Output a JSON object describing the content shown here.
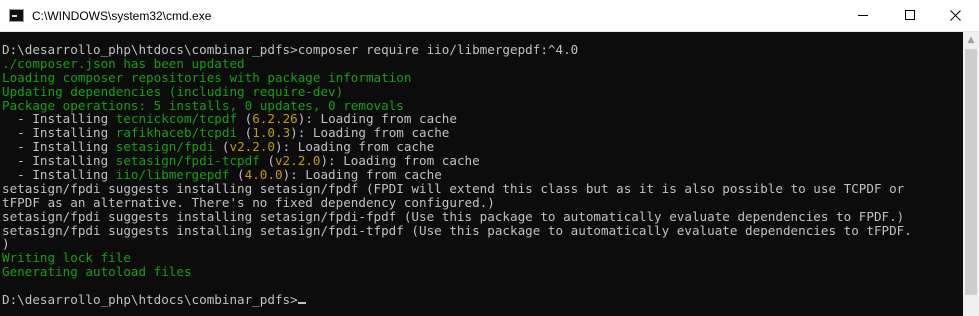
{
  "window": {
    "title": "C:\\WINDOWS\\system32\\cmd.exe"
  },
  "console": {
    "command_prompt": "D:\\desarrollo_php\\htdocs\\combinar_pdfs>composer require iio/libmergepdf:^4.0",
    "updated_json": "./composer.json has been updated",
    "loading_repos": "Loading composer repositories with package information",
    "updating_deps": "Updating dependencies (including require-dev)",
    "package_ops": "Package operations: 5 installs, 0 updates, 0 removals",
    "installs": [
      {
        "prefix": "  - Installing ",
        "name": "tecnickcom/tcpdf",
        "version": "6.2.26",
        "suffix": "): Loading from cache"
      },
      {
        "prefix": "  - Installing ",
        "name": "rafikhaceb/tcpdi",
        "version": "1.0.3",
        "suffix": "): Loading from cache"
      },
      {
        "prefix": "  - Installing ",
        "name": "setasign/fpdi",
        "version": "v2.2.0",
        "suffix": "): Loading from cache"
      },
      {
        "prefix": "  - Installing ",
        "name": "setasign/fpdi-tcpdf",
        "version": "v2.2.0",
        "suffix": "): Loading from cache"
      },
      {
        "prefix": "  - Installing ",
        "name": "iio/libmergepdf",
        "version": "4.0.0",
        "suffix": "): Loading from cache"
      }
    ],
    "suggest_lines": [
      "setasign/fpdi suggests installing setasign/fpdf (FPDI will extend this class but as it is also possible to use TCPDF or",
      "tFPDF as an alternative. There's no fixed dependency configured.)",
      "setasign/fpdi suggests installing setasign/fpdi-fpdf (Use this package to automatically evaluate dependencies to FPDF.)",
      "setasign/fpdi suggests installing setasign/fpdi-tfpdf (Use this package to automatically evaluate dependencies to tFPDF.",
      ")"
    ],
    "writing_lock": "Writing lock file",
    "generating_autoload": "Generating autoload files",
    "final_prompt": "D:\\desarrollo_php\\htdocs\\combinar_pdfs>"
  },
  "colors": {
    "background": "#0c0c0c",
    "text": "#c0c0c0",
    "green": "#13a10e",
    "yellow": "#c19c00"
  },
  "icons": {
    "app": "cmd-icon",
    "minimize": "minimize-icon",
    "maximize": "maximize-icon",
    "close": "close-icon",
    "scroll_up": "scroll-up-arrow-icon"
  }
}
